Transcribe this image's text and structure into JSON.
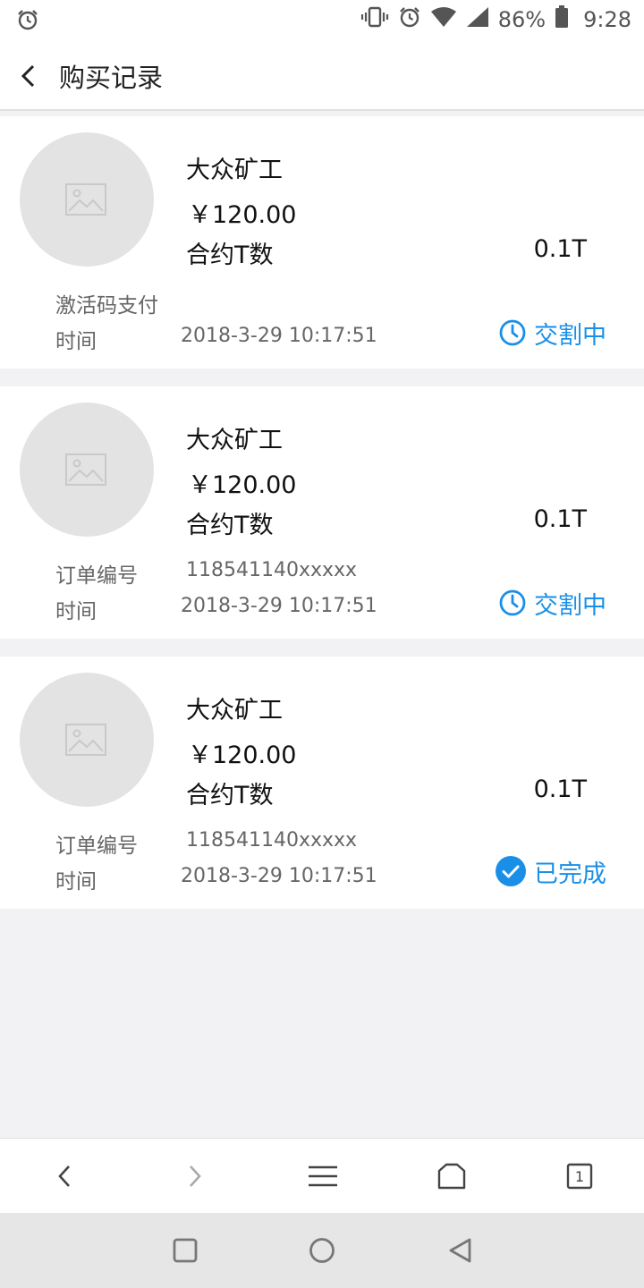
{
  "status_bar": {
    "battery": "86%",
    "time": "9:28"
  },
  "header": {
    "title": "购买记录",
    "back_icon": "chevron-left-icon"
  },
  "orders": [
    {
      "name": "大众矿工",
      "price": "￥120.00",
      "contract_label": "合约T数",
      "contract_value": "0.1T",
      "row1_label": "激活码支付",
      "row1_value": "",
      "time_label": "时间",
      "time_value": "2018-3-29 10:17:51",
      "status": "交割中",
      "status_icon": "clock-icon"
    },
    {
      "name": "大众矿工",
      "price": "￥120.00",
      "contract_label": "合约T数",
      "contract_value": "0.1T",
      "row1_label": "订单编号",
      "row1_value": "118541140xxxxx",
      "time_label": "时间",
      "time_value": "2018-3-29 10:17:51",
      "status": "交割中",
      "status_icon": "clock-icon"
    },
    {
      "name": "大众矿工",
      "price": "￥120.00",
      "contract_label": "合约T数",
      "contract_value": "0.1T",
      "row1_label": "订单编号",
      "row1_value": "118541140xxxxx",
      "time_label": "时间",
      "time_value": "2018-3-29 10:17:51",
      "status": "已完成",
      "status_icon": "check-circle-icon"
    }
  ],
  "colors": {
    "accent": "#1a8fe8",
    "page_bg": "#f2f2f4",
    "thumb_bg": "#e3e3e3"
  },
  "browser_nav": [
    "back-icon",
    "forward-icon",
    "menu-icon",
    "home-icon",
    "tabs-icon"
  ],
  "browser_tab_count": "1",
  "system_nav": [
    "recents-icon",
    "home-circle-icon",
    "back-triangle-icon"
  ]
}
